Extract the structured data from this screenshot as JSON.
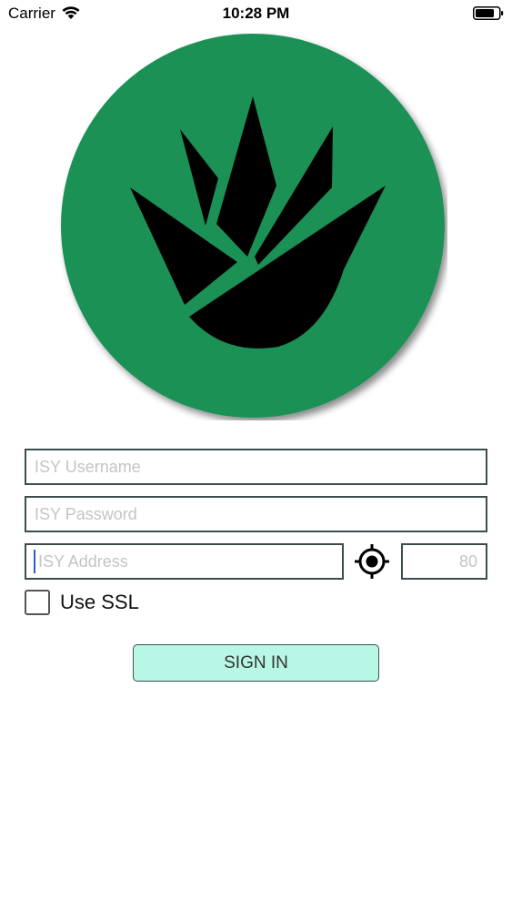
{
  "status_bar": {
    "carrier": "Carrier",
    "time": "10:28 PM"
  },
  "brand": {
    "logo_color": "#1a9157",
    "logo_mark_color": "#000000"
  },
  "form": {
    "username_placeholder": "ISY Username",
    "password_placeholder": "ISY Password",
    "address_placeholder": "ISY Address",
    "port_placeholder": "80",
    "ssl_label": "Use SSL",
    "ssl_checked": false,
    "signin_label": "SIGN IN",
    "signin_bg": "#b8f7e5"
  },
  "icons": {
    "wifi": "wifi-icon",
    "battery": "battery-icon",
    "locate": "crosshair-locate-icon"
  }
}
